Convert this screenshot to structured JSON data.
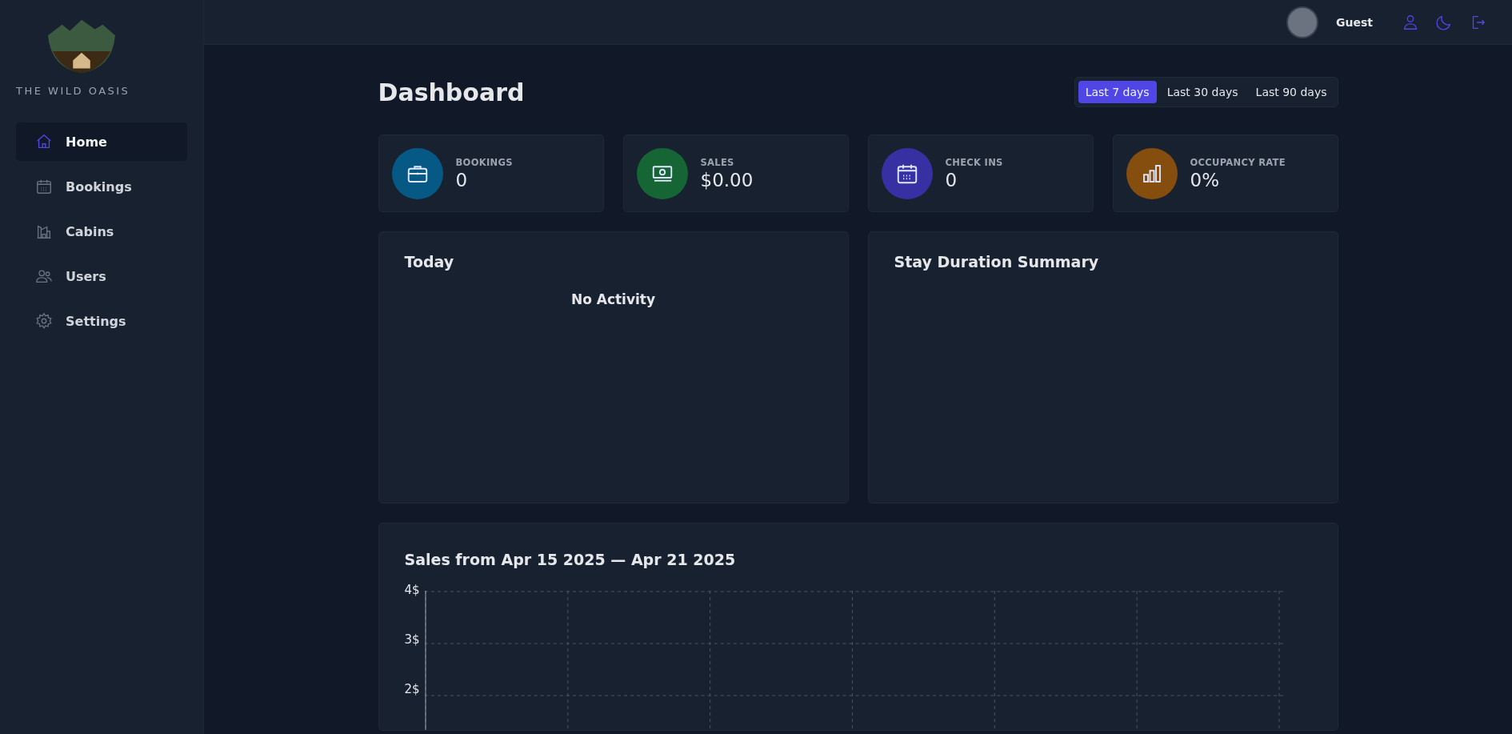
{
  "sidebar": {
    "brand": "THE WILD OASIS",
    "items": [
      {
        "label": "Home",
        "kind": "home",
        "selected": true
      },
      {
        "label": "Bookings",
        "kind": "calendar",
        "selected": false
      },
      {
        "label": "Cabins",
        "kind": "cabin",
        "selected": false
      },
      {
        "label": "Users",
        "kind": "users",
        "selected": false
      },
      {
        "label": "Settings",
        "kind": "settings",
        "selected": false
      }
    ]
  },
  "header": {
    "user": "Guest"
  },
  "title": "Dashboard",
  "filters": [
    {
      "label": "Last 7 days",
      "selected": true
    },
    {
      "label": "Last 30 days",
      "selected": false
    },
    {
      "label": "Last 90 days",
      "selected": false
    }
  ],
  "stats": [
    {
      "label": "BOOKINGS",
      "value": "0",
      "kind": "briefcase",
      "color": "#075985"
    },
    {
      "label": "SALES",
      "value": "$0.00",
      "kind": "money",
      "color": "#166534"
    },
    {
      "label": "CHECK INS",
      "value": "0",
      "kind": "calendar",
      "color": "#3730a3"
    },
    {
      "label": "OCCUPANCY RATE",
      "value": "0%",
      "kind": "chart",
      "color": "#854d0e"
    }
  ],
  "today": {
    "title": "Today",
    "message": "No Activity"
  },
  "duration": {
    "title": "Stay Duration Summary"
  },
  "sales": {
    "title": "Sales from Apr 15 2025 — Apr 21 2025",
    "y_ticks": [
      "4$",
      "3$",
      "2$"
    ]
  }
}
